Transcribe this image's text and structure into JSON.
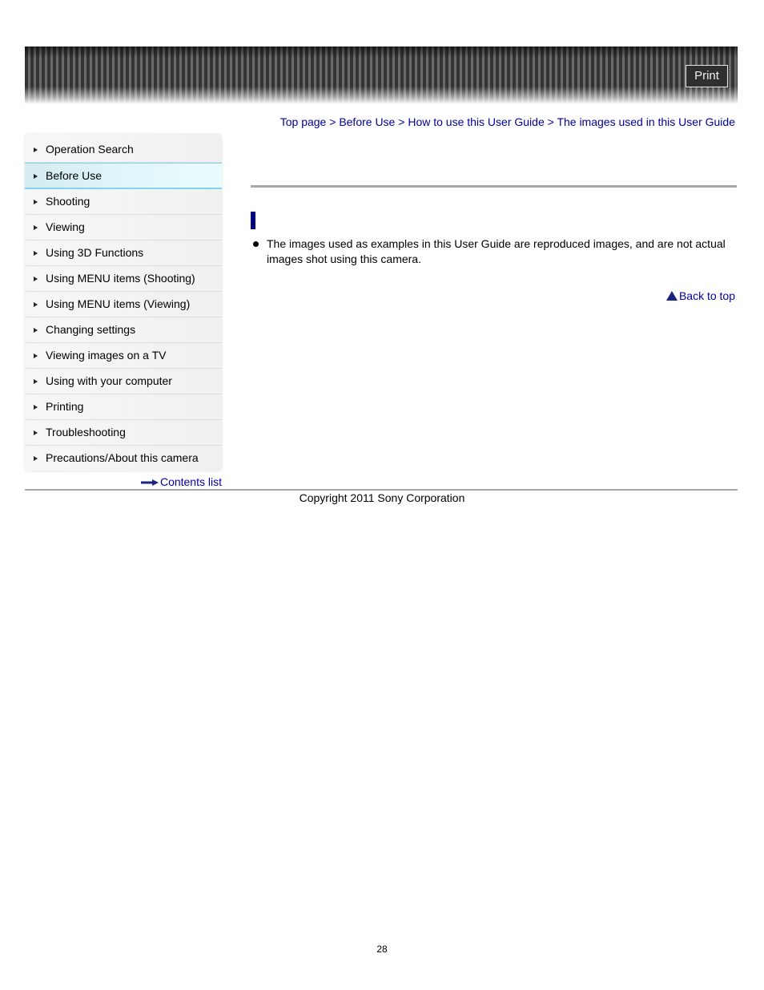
{
  "header": {
    "print_label": "Print"
  },
  "breadcrumb": {
    "items": [
      "Top page",
      "Before Use",
      "How to use this User Guide",
      "The images used in this User Guide"
    ],
    "separator": ">"
  },
  "sidebar": {
    "items": [
      {
        "label": "Operation Search",
        "active": false
      },
      {
        "label": "Before Use",
        "active": true
      },
      {
        "label": "Shooting",
        "active": false
      },
      {
        "label": "Viewing",
        "active": false
      },
      {
        "label": "Using 3D Functions",
        "active": false
      },
      {
        "label": "Using MENU items (Shooting)",
        "active": false
      },
      {
        "label": "Using MENU items (Viewing)",
        "active": false
      },
      {
        "label": "Changing settings",
        "active": false
      },
      {
        "label": "Viewing images on a TV",
        "active": false
      },
      {
        "label": "Using with your computer",
        "active": false
      },
      {
        "label": "Printing",
        "active": false
      },
      {
        "label": "Troubleshooting",
        "active": false
      },
      {
        "label": "Precautions/About this camera",
        "active": false
      }
    ],
    "contents_link": "Contents list"
  },
  "main": {
    "bullets": [
      "The images used as examples in this User Guide are reproduced images, and are not actual images shot using this camera."
    ],
    "back_to_top": "Back to top"
  },
  "footer": {
    "copyright": "Copyright 2011 Sony Corporation",
    "page_number": "28"
  },
  "colors": {
    "link": "#0000a0",
    "heading_bar": "#000080",
    "active_item_border": "#7fd4ee"
  }
}
